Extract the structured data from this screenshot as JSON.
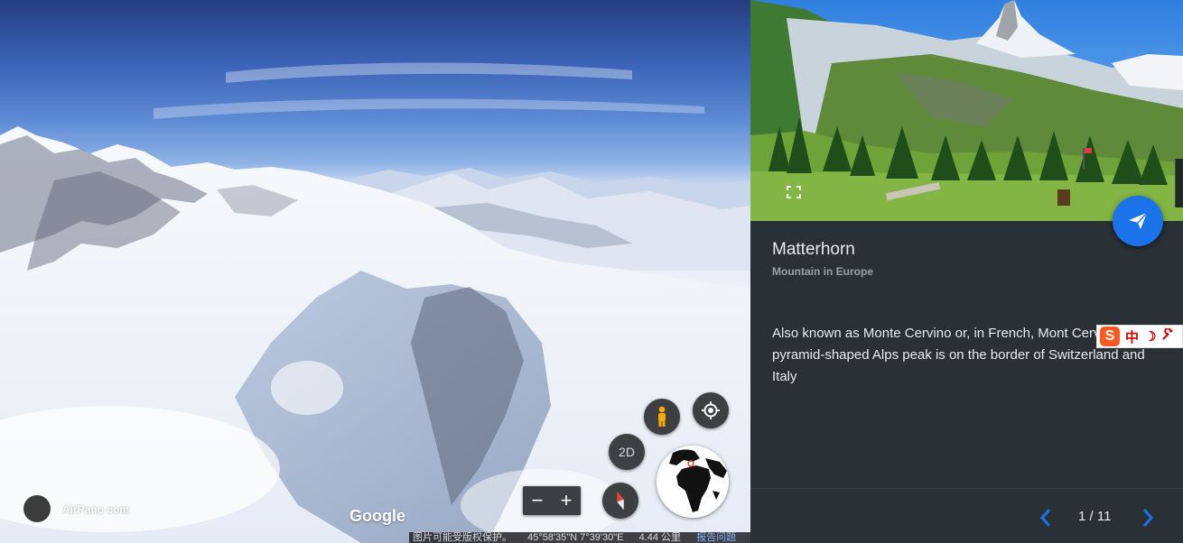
{
  "viewport": {
    "attribution": "AirPano com",
    "brand": "Google",
    "status_bar": {
      "notice": "图片可能受版权保护。",
      "coordinates": "45°58'35\"N 7°39'30\"E",
      "scale": "4.44 公里",
      "report": "报告问题"
    },
    "controls": {
      "view_mode_label": "2D",
      "zoom_out": "−",
      "zoom_in": "+"
    },
    "icons": [
      "pegman-icon",
      "my-location-icon",
      "compass-icon",
      "globe-icon",
      "zoom-out-icon",
      "zoom-in-icon"
    ]
  },
  "card": {
    "title": "Matterhorn",
    "subtitle": "Mountain in Europe",
    "description": "Also known as Monte Cervino or, in French, Mont Cervin, this pyramid-shaped Alps peak is on the border of Switzerland and Italy",
    "pager": {
      "current_of_total": "1 / 11"
    },
    "icons": [
      "expand-icon",
      "share-icon",
      "chevron-left-icon",
      "chevron-right-icon"
    ]
  },
  "ime_toolbar": {
    "logo": "S",
    "mode": "中",
    "icons": [
      "sogou-logo-icon",
      "moon-icon",
      "wrench-icon"
    ]
  },
  "colors": {
    "panel_bg": "#293036",
    "accent_blue": "#1a73e8",
    "button_bg": "#3c4043"
  }
}
